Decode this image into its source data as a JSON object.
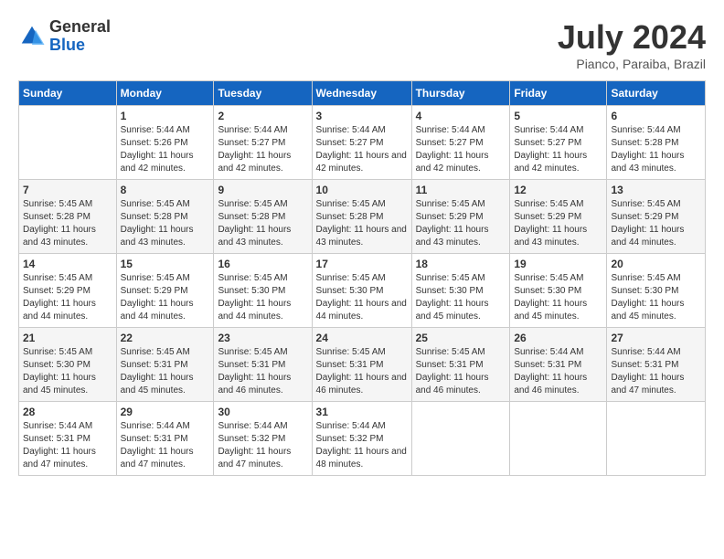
{
  "header": {
    "logo_general": "General",
    "logo_blue": "Blue",
    "month_title": "July 2024",
    "location": "Pianco, Paraiba, Brazil"
  },
  "days_of_week": [
    "Sunday",
    "Monday",
    "Tuesday",
    "Wednesday",
    "Thursday",
    "Friday",
    "Saturday"
  ],
  "weeks": [
    [
      {
        "day": "",
        "info": ""
      },
      {
        "day": "1",
        "info": "Sunrise: 5:44 AM\nSunset: 5:26 PM\nDaylight: 11 hours and 42 minutes."
      },
      {
        "day": "2",
        "info": "Sunrise: 5:44 AM\nSunset: 5:27 PM\nDaylight: 11 hours and 42 minutes."
      },
      {
        "day": "3",
        "info": "Sunrise: 5:44 AM\nSunset: 5:27 PM\nDaylight: 11 hours and 42 minutes."
      },
      {
        "day": "4",
        "info": "Sunrise: 5:44 AM\nSunset: 5:27 PM\nDaylight: 11 hours and 42 minutes."
      },
      {
        "day": "5",
        "info": "Sunrise: 5:44 AM\nSunset: 5:27 PM\nDaylight: 11 hours and 42 minutes."
      },
      {
        "day": "6",
        "info": "Sunrise: 5:44 AM\nSunset: 5:28 PM\nDaylight: 11 hours and 43 minutes."
      }
    ],
    [
      {
        "day": "7",
        "info": "Sunrise: 5:45 AM\nSunset: 5:28 PM\nDaylight: 11 hours and 43 minutes."
      },
      {
        "day": "8",
        "info": "Sunrise: 5:45 AM\nSunset: 5:28 PM\nDaylight: 11 hours and 43 minutes."
      },
      {
        "day": "9",
        "info": "Sunrise: 5:45 AM\nSunset: 5:28 PM\nDaylight: 11 hours and 43 minutes."
      },
      {
        "day": "10",
        "info": "Sunrise: 5:45 AM\nSunset: 5:28 PM\nDaylight: 11 hours and 43 minutes."
      },
      {
        "day": "11",
        "info": "Sunrise: 5:45 AM\nSunset: 5:29 PM\nDaylight: 11 hours and 43 minutes."
      },
      {
        "day": "12",
        "info": "Sunrise: 5:45 AM\nSunset: 5:29 PM\nDaylight: 11 hours and 43 minutes."
      },
      {
        "day": "13",
        "info": "Sunrise: 5:45 AM\nSunset: 5:29 PM\nDaylight: 11 hours and 44 minutes."
      }
    ],
    [
      {
        "day": "14",
        "info": "Sunrise: 5:45 AM\nSunset: 5:29 PM\nDaylight: 11 hours and 44 minutes."
      },
      {
        "day": "15",
        "info": "Sunrise: 5:45 AM\nSunset: 5:29 PM\nDaylight: 11 hours and 44 minutes."
      },
      {
        "day": "16",
        "info": "Sunrise: 5:45 AM\nSunset: 5:30 PM\nDaylight: 11 hours and 44 minutes."
      },
      {
        "day": "17",
        "info": "Sunrise: 5:45 AM\nSunset: 5:30 PM\nDaylight: 11 hours and 44 minutes."
      },
      {
        "day": "18",
        "info": "Sunrise: 5:45 AM\nSunset: 5:30 PM\nDaylight: 11 hours and 45 minutes."
      },
      {
        "day": "19",
        "info": "Sunrise: 5:45 AM\nSunset: 5:30 PM\nDaylight: 11 hours and 45 minutes."
      },
      {
        "day": "20",
        "info": "Sunrise: 5:45 AM\nSunset: 5:30 PM\nDaylight: 11 hours and 45 minutes."
      }
    ],
    [
      {
        "day": "21",
        "info": "Sunrise: 5:45 AM\nSunset: 5:30 PM\nDaylight: 11 hours and 45 minutes."
      },
      {
        "day": "22",
        "info": "Sunrise: 5:45 AM\nSunset: 5:31 PM\nDaylight: 11 hours and 45 minutes."
      },
      {
        "day": "23",
        "info": "Sunrise: 5:45 AM\nSunset: 5:31 PM\nDaylight: 11 hours and 46 minutes."
      },
      {
        "day": "24",
        "info": "Sunrise: 5:45 AM\nSunset: 5:31 PM\nDaylight: 11 hours and 46 minutes."
      },
      {
        "day": "25",
        "info": "Sunrise: 5:45 AM\nSunset: 5:31 PM\nDaylight: 11 hours and 46 minutes."
      },
      {
        "day": "26",
        "info": "Sunrise: 5:44 AM\nSunset: 5:31 PM\nDaylight: 11 hours and 46 minutes."
      },
      {
        "day": "27",
        "info": "Sunrise: 5:44 AM\nSunset: 5:31 PM\nDaylight: 11 hours and 47 minutes."
      }
    ],
    [
      {
        "day": "28",
        "info": "Sunrise: 5:44 AM\nSunset: 5:31 PM\nDaylight: 11 hours and 47 minutes."
      },
      {
        "day": "29",
        "info": "Sunrise: 5:44 AM\nSunset: 5:31 PM\nDaylight: 11 hours and 47 minutes."
      },
      {
        "day": "30",
        "info": "Sunrise: 5:44 AM\nSunset: 5:32 PM\nDaylight: 11 hours and 47 minutes."
      },
      {
        "day": "31",
        "info": "Sunrise: 5:44 AM\nSunset: 5:32 PM\nDaylight: 11 hours and 48 minutes."
      },
      {
        "day": "",
        "info": ""
      },
      {
        "day": "",
        "info": ""
      },
      {
        "day": "",
        "info": ""
      }
    ]
  ]
}
